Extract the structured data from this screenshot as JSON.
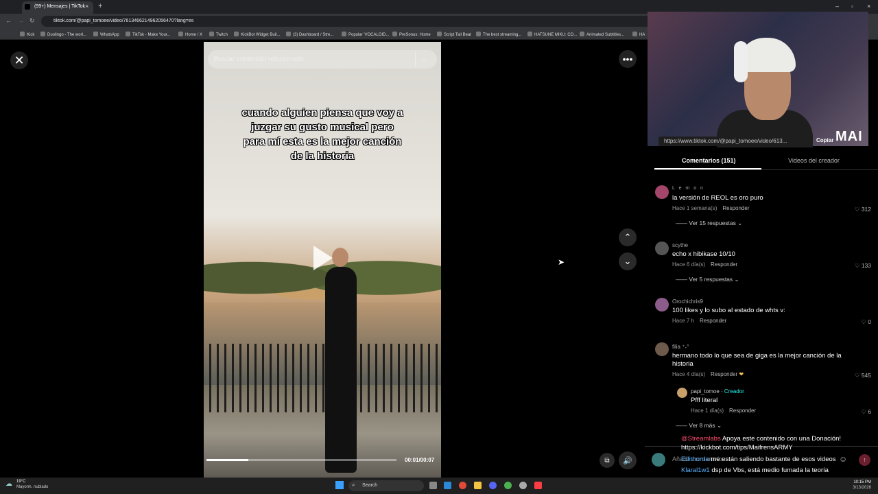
{
  "browser": {
    "tab_title": "(99+) Mensajes | TikTok",
    "url": "tiktok.com/@papi_tomoee/video/7613466214962056470?lang=es",
    "bookmarks": [
      "Kick",
      "Duolingo - The worl...",
      "WhatsApp",
      "TikTok - Make Your...",
      "Home / X",
      "Twitch",
      "KickBot Widget Buil...",
      "(3) Dashboard / Stre...",
      "Popular 'VOCALOID...",
      "PreSonus: Home",
      "Script Tail Beat",
      "The best streaming...",
      "HATSUNE MIKU: CO...",
      "Animated Subtitles...",
      "HA"
    ]
  },
  "video": {
    "search_placeholder": "Buscar contenido relacionado",
    "overlay_text": "cuando alguien piensa que voy a juzgar su gusto musical pero para mí esta es la mejor canción de la historia",
    "time": "00:01/00:07",
    "progress": 0.22
  },
  "webcam": {
    "brand": "MAI"
  },
  "panel": {
    "link": "https://www.tiktok.com/@papi_tomoee/video/613...",
    "copy_label": "Copiar",
    "tab_comments": "Comentarios (151)",
    "tab_creator": "Videos del creador",
    "reply_label": "Responder",
    "comments": [
      {
        "name": "L e m o n",
        "text": "la versión de REOL es oro puro",
        "time": "Hace 1 semana(s)",
        "likes": "312",
        "replies": "Ver 15 respuestas"
      },
      {
        "name": "scythe",
        "text": "echo x hibikase 10/10",
        "time": "Hace 6 día(s)",
        "likes": "133",
        "replies": "Ver 5 respuestas"
      },
      {
        "name": "Orochichris9",
        "text": "100 likes y lo subo al estado de whts v:",
        "time": "Hace 7 h",
        "likes": "0"
      },
      {
        "name": "filia ⁺˖°",
        "text": "hermano todo lo que sea de giga es la mejor canción de la historia",
        "time": "Hace 4 día(s)",
        "likes": "545"
      }
    ],
    "reply": {
      "name": "papi_tomoe",
      "badge": "Creador",
      "text": "Pfff literal",
      "time": "Hace 1 día(s)",
      "likes": "6"
    },
    "more_replies": "Ver 8 más",
    "comment_input_placeholder": "Añadir comentario..."
  },
  "chat": [
    {
      "user": "@Streamlabs",
      "text": "Apoya este contenido con una Donación!"
    },
    {
      "user": "",
      "text": "https://kickbot.com/tips/MaifrensARMY"
    },
    {
      "user": "Edithorda",
      "text": "me están saliendo bastante de esos videos"
    },
    {
      "user": "Klaral1w1",
      "text": "dsp de Vbs, está medio fumada la teoría"
    }
  ],
  "taskbar": {
    "weather_temp": "19°C",
    "weather_desc": "Mayorm. nublado",
    "search": "Search",
    "time": "10:15 PM",
    "date": "3/13/2026"
  },
  "colors": {
    "creator_badge": "#25f4ee",
    "chat_user": "#ff4d6d",
    "chat_user2": "#5ab4ff",
    "tiktok_red": "#fe2c55"
  }
}
